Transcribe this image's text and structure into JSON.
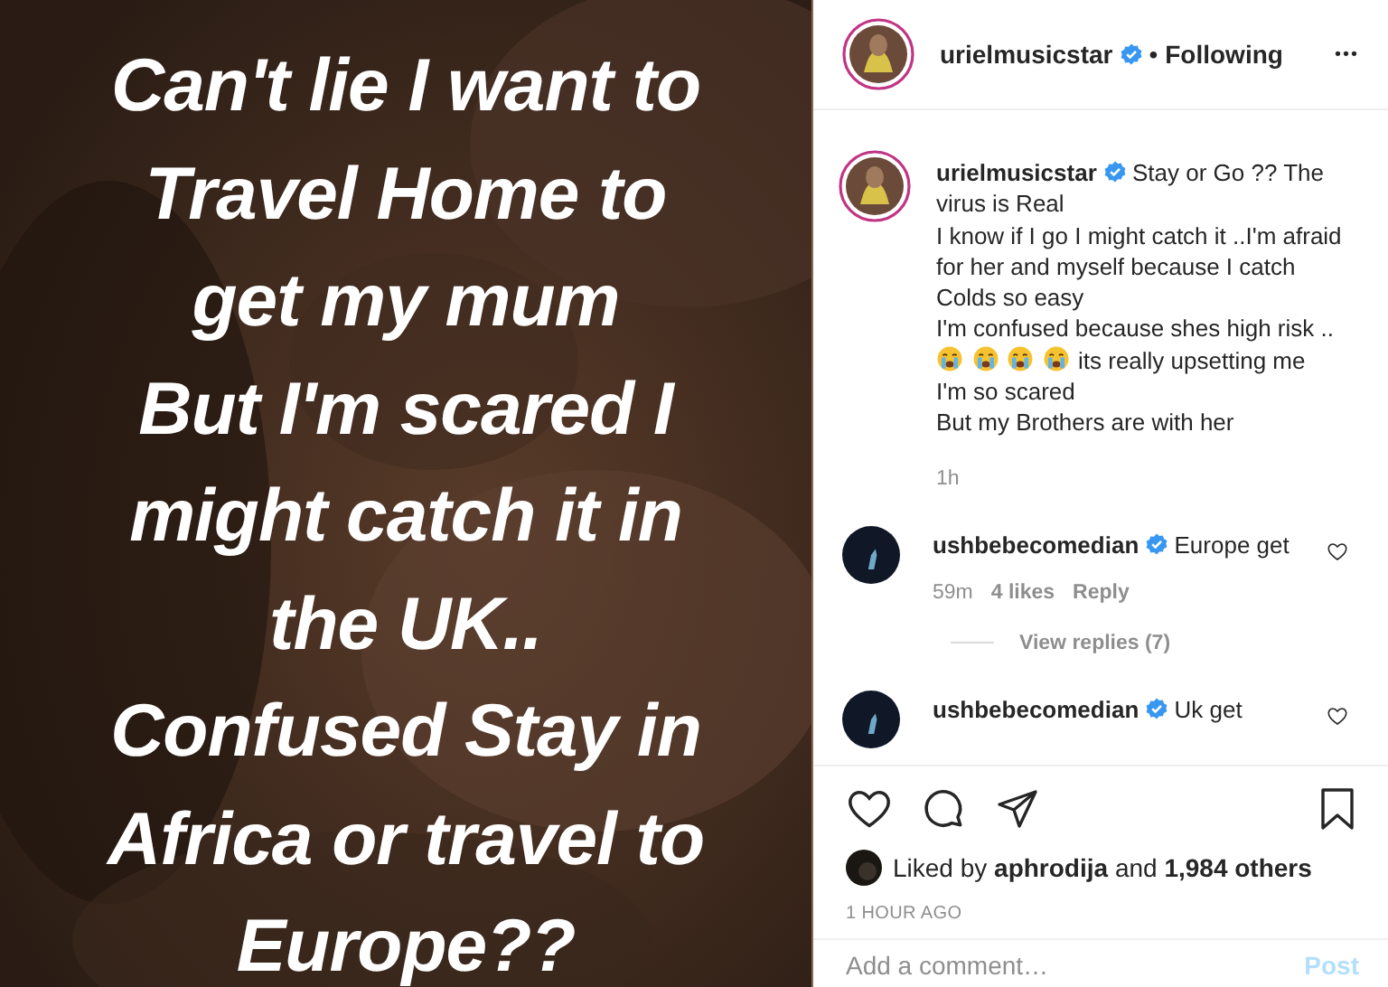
{
  "post_image": {
    "lines": [
      "Can't lie I want to",
      "Travel Home to",
      "get my mum",
      "But I'm scared I",
      "might catch it in",
      "the UK..",
      "Confused Stay in",
      "Africa or travel to",
      "Europe??"
    ]
  },
  "header": {
    "username": "urielmusicstar",
    "verified": true,
    "separator": "•",
    "follow_status": "Following",
    "more": "•••"
  },
  "caption": {
    "username": "urielmusicstar",
    "verified": true,
    "lines": [
      {
        "text": "Stay or Go ?? The virus is Real"
      },
      {
        "text": "I know if I go I might catch it ..I'm afraid for her and myself because I catch Colds so easy"
      },
      {
        "text": "I'm confused because shes high risk .."
      },
      {
        "emojis": [
          {
            "kind": "crying"
          },
          {
            "kind": "crying"
          },
          {
            "kind": "crying"
          },
          {
            "kind": "crying"
          }
        ],
        "text": "its really upsetting me"
      },
      {
        "text": "I'm so scared"
      },
      {
        "text": "But my Brothers are with her"
      }
    ],
    "time": "1h"
  },
  "comments": [
    {
      "username": "ushbebecomedian",
      "verified": true,
      "text": "Europe get",
      "time": "59m",
      "likes": "4 likes",
      "reply": "Reply",
      "view_replies": "View replies (7)",
      "liked": false
    },
    {
      "username": "ushbebecomedian",
      "verified": true,
      "text": "Uk get",
      "liked": false
    }
  ],
  "actions": {
    "liked": false,
    "saved": false
  },
  "likes": "Liked by **aphrodija** and **1,984 others**",
  "timestamp": "1 HOUR AGO",
  "comment_box": {
    "placeholder": "Add a comment…",
    "post": "Post"
  }
}
